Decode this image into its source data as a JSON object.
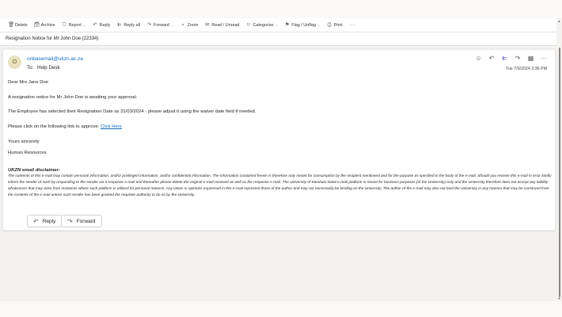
{
  "toolbar": {
    "items": [
      {
        "label": "Delete",
        "icon": "trash-icon",
        "glyph": "🗑",
        "caret": false
      },
      {
        "label": "Archive",
        "icon": "archive-icon",
        "glyph": "🗃",
        "caret": false
      },
      {
        "label": "Report",
        "icon": "shield-report-icon",
        "glyph": "⛉",
        "caret": true
      },
      {
        "label": "Reply",
        "icon": "reply-icon",
        "glyph": "↶",
        "caret": false
      },
      {
        "label": "Reply all",
        "icon": "reply-all-icon",
        "glyph": "⇇",
        "caret": false
      },
      {
        "label": "Forward",
        "icon": "forward-icon",
        "glyph": "↷",
        "caret": true
      },
      {
        "label": "Zoom",
        "icon": "zoom-icon",
        "glyph": "⌕",
        "caret": false
      },
      {
        "label": "Read / Unread",
        "icon": "envelope-icon",
        "glyph": "✉",
        "caret": false
      },
      {
        "label": "Categorize",
        "icon": "tag-icon",
        "glyph": "⌑",
        "caret": true
      },
      {
        "label": "Flag / Unflag",
        "icon": "flag-icon",
        "glyph": "⚑",
        "caret": true
      },
      {
        "label": "Print",
        "icon": "printer-icon",
        "glyph": "⎙",
        "caret": false
      }
    ],
    "more_glyph": "···"
  },
  "subject": "Resignation Notice for Mr John Doe (22334)",
  "message": {
    "avatar_initial": "O",
    "from": "onbasemail@ukzn.ac.za",
    "to_label": "To:",
    "to": "Help Desk",
    "date": "Tue 7/9/2024 3:36 PM",
    "greeting": "Dear Mrs Jane Doe",
    "line1": "A resignation notice for Mr John Doe is awaiting your approval.",
    "line2": "The Employee has selected their Resignation Date as 31/03/2024 - please adjust it using the waiver date field if needed.",
    "line3_prefix": "Please click on the following link to approve: ",
    "link_text": "Click Here",
    "closing": "Yours sincerely",
    "signature": "Human Resources",
    "disclaimer_title": "UKZN email disclaimer:",
    "disclaimer": "The contents of this e-mail may contain personal information, and/or privileged information, and/or confidential information. The information contained herein is therefore only meant for consumption by the recipient mentioned and for the purpose as specified in the body of the e-mail. Should you receive this e-mail in error kindly inform the sender of such by responding to the sender via a response e-mail and thereafter please delete the original e-mail received as well as the response e-mail. The University of KwaZulu-Natal e-mail platform is meant for business purposes (of the University) only and the University therefore does not accept any liability whatsoever that may arise from instances where such platform is utilised for personal reasons. Any views or opinions expressed in this e-mail represent those of the author and may not necessarily be binding on the University. The author of the e-mail may also not bind the University in any manner that may be construed from the contents of the e-mail unless such sender has been granted the requisite authority to do so by the University."
  },
  "header_actions": [
    {
      "name": "emoji-icon",
      "glyph": "☺",
      "color": "#605e5c"
    },
    {
      "name": "reply-icon",
      "glyph": "↶",
      "color": "#605e5c"
    },
    {
      "name": "reply-all-icon",
      "glyph": "⇇",
      "color": "#5b5fc7"
    },
    {
      "name": "forward-icon",
      "glyph": "↷",
      "color": "#605e5c"
    },
    {
      "name": "grid-icon",
      "glyph": "▦",
      "color": "#605e5c"
    },
    {
      "name": "more-icon",
      "glyph": "···",
      "color": "#605e5c"
    }
  ],
  "buttons": {
    "reply_label": "Reply",
    "forward_label": "Forward"
  },
  "colors": {
    "accent": "#0f6cbd",
    "avatar_bg": "#e8e1bf"
  }
}
